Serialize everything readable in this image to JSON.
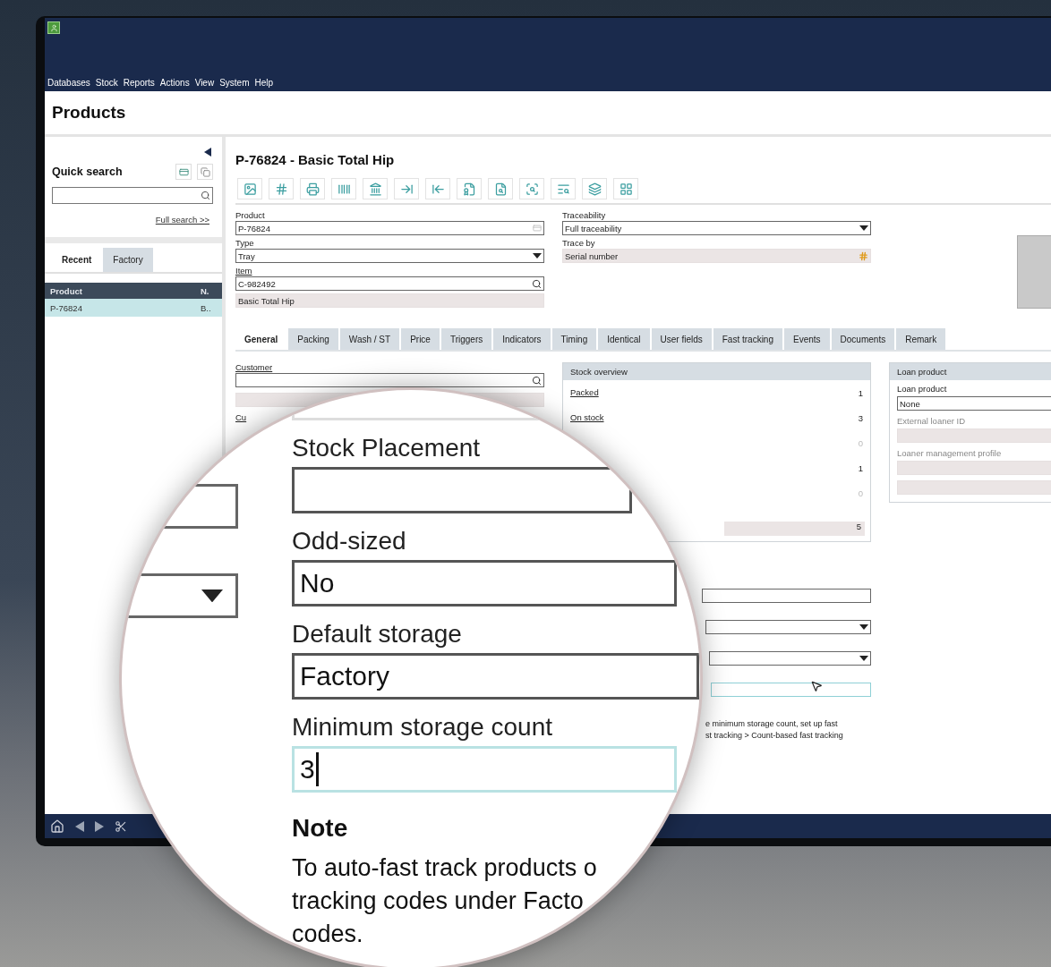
{
  "menu": [
    "Databases",
    "Stock",
    "Reports",
    "Actions",
    "View",
    "System",
    "Help"
  ],
  "page_title": "Products",
  "sidebar": {
    "title": "Quick search",
    "full_search_link": "Full search >>",
    "tabs": [
      {
        "label": "Recent",
        "selected": true
      },
      {
        "label": "Factory",
        "selected": false
      }
    ],
    "table": {
      "columns": [
        "Product",
        "N."
      ],
      "rows": [
        {
          "cells": [
            "P-76824",
            "B.."
          ],
          "selected": true
        }
      ]
    }
  },
  "record": {
    "title": "P-76824 - Basic Total Hip",
    "fields_left": [
      {
        "kind": "text",
        "label": "Product",
        "value": "P-76824",
        "link": false
      },
      {
        "kind": "dropdown",
        "label": "Type",
        "value": "Tray",
        "link": false
      },
      {
        "kind": "lookup",
        "label": "Item",
        "value": "C-982492",
        "link": true
      },
      {
        "kind": "readonly",
        "value": "Basic Total Hip"
      }
    ],
    "fields_right": [
      {
        "kind": "dropdown",
        "label": "Traceability",
        "value": "Full traceability",
        "link": false
      },
      {
        "kind": "serial",
        "label": "Trace by",
        "value": "Serial number",
        "link": false
      }
    ]
  },
  "tabs": [
    {
      "label": "General",
      "selected": true
    },
    {
      "label": "Packing",
      "selected": false
    },
    {
      "label": "Wash / ST",
      "selected": false
    },
    {
      "label": "Price",
      "selected": false
    },
    {
      "label": "Triggers",
      "selected": false
    },
    {
      "label": "Indicators",
      "selected": false
    },
    {
      "label": "Timing",
      "selected": false
    },
    {
      "label": "Identical",
      "selected": false
    },
    {
      "label": "User fields",
      "selected": false
    },
    {
      "label": "Fast tracking",
      "selected": false
    },
    {
      "label": "Events",
      "selected": false
    },
    {
      "label": "Documents",
      "selected": false
    },
    {
      "label": "Remark",
      "selected": false
    }
  ],
  "general": {
    "customer_label": "Customer",
    "partial_label": "Cu",
    "stock_overview": {
      "title": "Stock overview",
      "rows": [
        {
          "label": "Packed",
          "value": "1",
          "dimmed": false
        },
        {
          "label": "On stock",
          "value": "3",
          "dimmed": false
        },
        {
          "value": "0",
          "dimmed": true
        },
        {
          "value": "1",
          "dimmed": false
        },
        {
          "value": "0",
          "dimmed": true
        }
      ],
      "total": "5"
    },
    "lower_fields": [
      {
        "kind": "text",
        "focused": false
      },
      {
        "kind": "dropdown",
        "focused": false
      },
      {
        "kind": "dropdown",
        "focused": false
      },
      {
        "kind": "text",
        "focused": true
      }
    ],
    "note_fragment": [
      "e minimum storage count, set up fast",
      "st tracking > Count-based fast tracking"
    ],
    "loan": {
      "title": "Loan product",
      "fields": [
        {
          "label": "Loan product",
          "value": "None",
          "disabled": false
        },
        {
          "label": "External loaner ID",
          "disabled": true
        },
        {
          "label": "Loaner management profile",
          "disabled": true
        },
        {
          "disabled": true
        }
      ]
    }
  },
  "magnifier": {
    "side_fields": [
      {
        "kind": "text"
      },
      {
        "kind": "dropdown"
      }
    ],
    "fields": [
      {
        "label": "Stock Placement",
        "focused": false
      },
      {
        "label": "Odd-sized",
        "value": "No",
        "focused": false
      },
      {
        "label": "Default storage",
        "value": "Factory",
        "focused": false
      },
      {
        "label": "Minimum storage count",
        "value": "3",
        "focused": true
      }
    ],
    "note": {
      "title": "Note",
      "lines": [
        "To auto-fast track products o",
        "tracking codes under Facto",
        "codes."
      ]
    }
  }
}
